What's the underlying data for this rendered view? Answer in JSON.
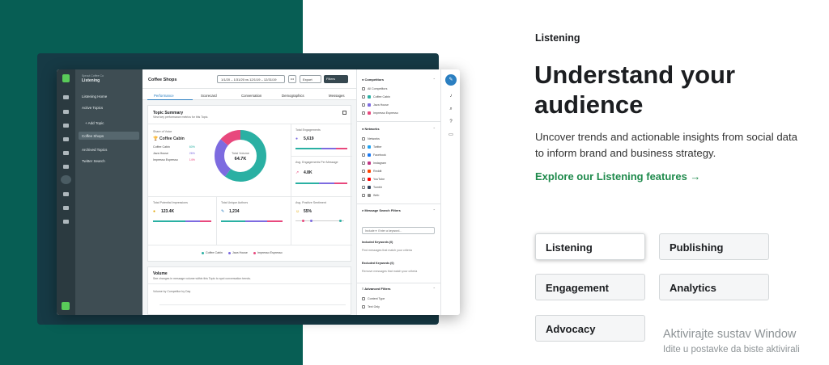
{
  "app": {
    "brand_sub": "Sprout Coffee Co",
    "brand": "Listening",
    "nav_items": [
      "Listening Home",
      "Active Topics",
      "Add Topic",
      "Coffee Shops",
      "Archived Topics",
      "Twitter Search"
    ],
    "page_title": "Coffee Shops",
    "date_range": "1/1/20 – 1/31/20 vs 12/1/19 – 12/31/19",
    "more_label": "•••",
    "export_label": "Export",
    "filters_label": "Filters",
    "tabs": [
      "Performance",
      "Scorecard",
      "Conversation",
      "Demographics",
      "Messages"
    ],
    "topic_summary_title": "Topic Summary",
    "topic_summary_sub": "View key performance metrics for this Topic.",
    "share_of_voice_label": "Share of Voice",
    "share_leader": "Coffee Cabin",
    "competitors": [
      {
        "name": "Coffee Cabin",
        "pct": "60%",
        "color": "#2ab0a3"
      },
      {
        "name": "Java House",
        "pct": "26%",
        "color": "#7d6be0"
      },
      {
        "name": "Impresso Espresso",
        "pct": "14%",
        "color": "#e8487d"
      }
    ],
    "donut_label": "Total Volume",
    "donut_value": "64.7K",
    "donut_shares": [
      60,
      26,
      14
    ],
    "stats": {
      "total_engagements_label": "Total Engagements",
      "total_engagements": "5,619",
      "avg_engagements_label": "Avg. Engagements Per Message",
      "avg_engagements": "4.8K",
      "impressions_label": "Total Potential Impressions",
      "impressions": "123.4K",
      "authors_label": "Total Unique Authors",
      "authors": "1,234",
      "sentiment_label": "Avg. Positive Sentiment",
      "sentiment": "55%"
    },
    "legend": [
      "Coffee Cabin",
      "Java House",
      "Impresso Espresso"
    ],
    "volume_title": "Volume",
    "volume_sub": "See changes in message volume within this Topic to spot conversation trends.",
    "volume_chart_label": "Volume by Competitor by Day",
    "sidebar": {
      "competitors_header": "Competitors",
      "competitors": [
        "All Competitors",
        "Coffee Cabin",
        "Java House",
        "Impresso Espresso"
      ],
      "networks_header": "Networks",
      "networks": [
        "Networks",
        "Twitter",
        "Facebook",
        "Instagram",
        "Reddit",
        "YouTube",
        "Tumblr",
        "Web"
      ],
      "search_filters_header": "Message Search Filters",
      "include_select": "Include",
      "keyword_placeholder": "Enter a keyword...",
      "included_keywords": "Included Keywords (0)",
      "included_hint": "Find messages that match your criteria",
      "excluded_keywords": "Excluded Keywords (0)",
      "excluded_hint": "Remove messages that match your criteria",
      "advanced_header": "Advanced Filters",
      "advanced": [
        "Content Type",
        "Text Only"
      ]
    }
  },
  "hero": {
    "eyebrow": "Listening",
    "headline": "Understand your audience",
    "lede": "Uncover trends and actionable insights from social data to inform brand and business strategy.",
    "link": "Explore our Listening features →",
    "pills": [
      "Listening",
      "Publishing",
      "Engagement",
      "Analytics",
      "Advocacy"
    ]
  },
  "watermark": {
    "line1": "Aktivirajte sustav Window",
    "line2": "Idite u postavke da biste aktivirali"
  },
  "colors": {
    "teal_bg": "#075e54",
    "accent_green": "#1f8a4c",
    "cabin": "#2ab0a3",
    "java": "#7d6be0",
    "impresso": "#e8487d"
  }
}
